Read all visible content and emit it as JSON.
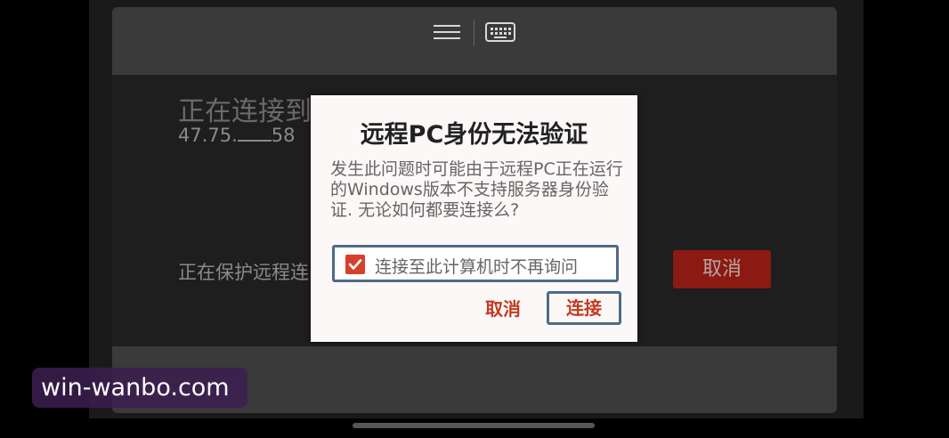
{
  "toolbar": {
    "menu_icon": "hamburger-menu-icon",
    "keyboard_icon": "keyboard-icon"
  },
  "background": {
    "connecting_title": "正在连接到",
    "ip_address": "47.75.",
    "ip_suffix": "58",
    "protecting_text": "正在保护远程连",
    "cancel_button": "取消"
  },
  "dialog": {
    "title": "远程PC身份无法验证",
    "message": "发生此问题时可能由于远程PC正在运行的Windows版本不支持服务器身份验证. 无论如何都要连接么?",
    "checkbox_label": "连接至此计算机时不再询问",
    "checkbox_checked": true,
    "cancel_button": "取消",
    "connect_button": "连接"
  },
  "watermark": {
    "text": "win-wanbo.com"
  },
  "colors": {
    "accent_red": "#c23b22",
    "checkbox_red": "#d6402b",
    "focus_border": "#4e6a86"
  }
}
